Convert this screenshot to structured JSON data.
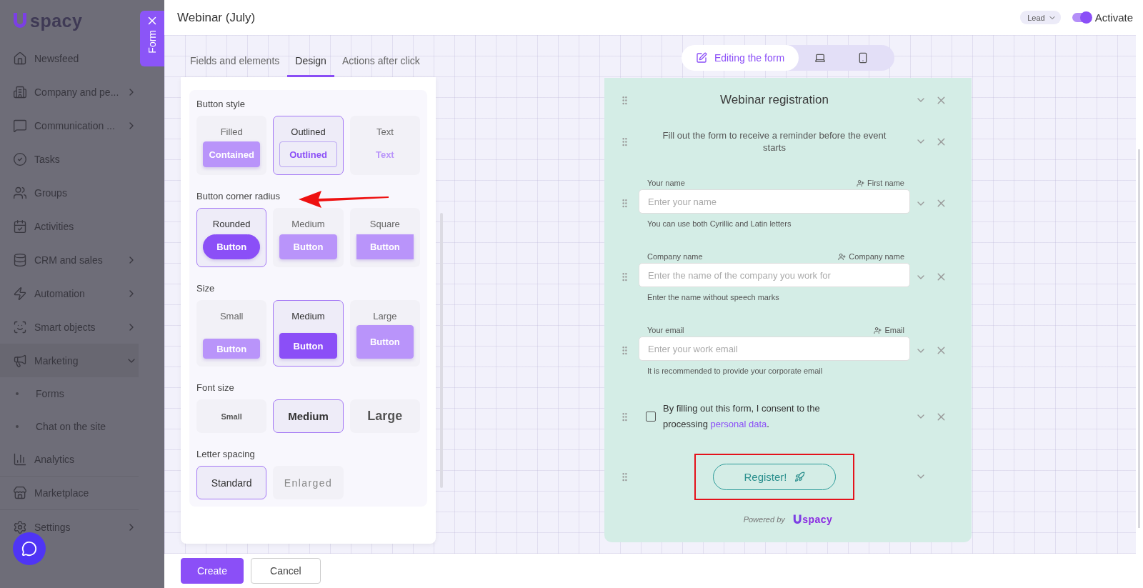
{
  "sidebar": {
    "logo": "spacy",
    "items": [
      {
        "label": "Newsfeed"
      },
      {
        "label": "Company and pe...",
        "expanded": false
      },
      {
        "label": "Communication ...",
        "expanded": false
      },
      {
        "label": "Tasks"
      },
      {
        "label": "Groups"
      },
      {
        "label": "Activities"
      },
      {
        "label": "CRM and sales",
        "expanded": false
      },
      {
        "label": "Automation",
        "expanded": false
      },
      {
        "label": "Smart objects",
        "expanded": false
      },
      {
        "label": "Marketing",
        "expanded": true,
        "children": [
          {
            "label": "Forms"
          },
          {
            "label": "Chat on the site"
          }
        ]
      },
      {
        "label": "Analytics"
      },
      {
        "label": "Marketplace"
      },
      {
        "label": "Settings",
        "expanded": false
      }
    ]
  },
  "drawer_tab": {
    "label": "Form"
  },
  "header": {
    "title": "Webinar (July)",
    "entity": "Lead",
    "activate": {
      "label": "Activate",
      "on": true
    }
  },
  "tabs": [
    {
      "label": "Fields and elements",
      "selected": false
    },
    {
      "label": "Design",
      "selected": true
    },
    {
      "label": "Actions after click",
      "selected": false
    }
  ],
  "design_sections": [
    {
      "title": "Button style",
      "kind": "style",
      "options": [
        {
          "label": "Filled",
          "kind": "filled",
          "sample": "Contained",
          "selected": false
        },
        {
          "label": "Outlined",
          "kind": "outlined",
          "sample": "Outlined",
          "selected": true
        },
        {
          "label": "Text",
          "kind": "text",
          "sample": "Text",
          "selected": false
        }
      ]
    },
    {
      "title": "Button corner radius",
      "kind": "radius",
      "options": [
        {
          "label": "Rounded",
          "kind": "rounded",
          "sample": "Button",
          "selected": true
        },
        {
          "label": "Medium",
          "kind": "medium",
          "sample": "Button",
          "selected": false
        },
        {
          "label": "Square",
          "kind": "square",
          "sample": "Button",
          "selected": false
        }
      ]
    },
    {
      "title": "Size",
      "kind": "size",
      "options": [
        {
          "label": "Small",
          "kind": "small",
          "sample": "Button",
          "selected": false
        },
        {
          "label": "Medium",
          "kind": "medium",
          "sample": "Button",
          "selected": true
        },
        {
          "label": "Large",
          "kind": "large",
          "sample": "Button",
          "selected": false
        }
      ]
    },
    {
      "title": "Font size",
      "kind": "font",
      "options": [
        {
          "label": "Small",
          "kind": "small",
          "selected": false
        },
        {
          "label": "Medium",
          "kind": "medium",
          "selected": true
        },
        {
          "label": "Large",
          "kind": "large",
          "selected": false
        }
      ]
    },
    {
      "title": "Letter spacing",
      "kind": "spacing",
      "options": [
        {
          "label": "Standard",
          "kind": "standard",
          "selected": true
        },
        {
          "label": "Enlarged",
          "kind": "enlarged",
          "selected": false
        }
      ]
    }
  ],
  "preview_modes": [
    {
      "kind": "edit",
      "label": "Editing the form",
      "selected": true
    },
    {
      "kind": "desktop",
      "selected": false
    },
    {
      "kind": "mobile",
      "selected": false
    }
  ],
  "form": {
    "title": "Webinar registration",
    "description": "Fill out the form to receive a reminder before the event starts",
    "fields": [
      {
        "label": "Your name",
        "mapping": "First name",
        "placeholder": "Enter your name",
        "hint": "You can use both Cyrillic and Latin letters"
      },
      {
        "label": "Company name",
        "mapping": "Company name",
        "placeholder": "Enter the name of the company you work for",
        "hint": "Enter the name without speech marks"
      },
      {
        "label": "Your email",
        "mapping": "Email",
        "placeholder": "Enter your work email",
        "hint": "It is recommended to provide your corporate email"
      }
    ],
    "consent": {
      "checked": false,
      "text": "By filling out this form, I consent to the processing ",
      "link": "personal data",
      "after": "."
    },
    "submit": "Register!",
    "powered_by": "Powered by",
    "logo": "spacy"
  },
  "footer": {
    "buttons": [
      {
        "label": "Create",
        "kind": "primary"
      },
      {
        "label": "Cancel",
        "kind": "secondary"
      }
    ]
  }
}
